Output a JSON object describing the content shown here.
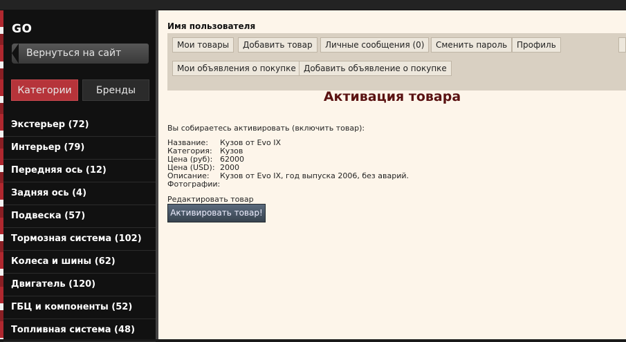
{
  "sidebar": {
    "brand": "GO",
    "back_label": "Вернуться на сайт",
    "tabs": {
      "categories": "Категории",
      "brands": "Бренды"
    },
    "categories": [
      "Экстерьер (72)",
      "Интерьер (79)",
      "Передняя ось (12)",
      "Задняя ось (4)",
      "Подвеска (57)",
      "Тормозная система (102)",
      "Колеса и шины (62)",
      "Двигатель (120)",
      "ГБЦ и компоненты (52)",
      "Топливная система (48)"
    ]
  },
  "main": {
    "user_title": "Имя пользователя",
    "menu": [
      "Мои товары",
      "Добавить товар",
      "Личные сообщения (0)",
      "Сменить пароль",
      "Профиль",
      "Мои объявления о покупке",
      "Добавить объявление о покупке"
    ],
    "heading": "Активация товара",
    "intro": "Вы собираетесь активировать (включить товар):",
    "fields": {
      "name": {
        "label": "Название:",
        "value": "Кузов от Evo IX"
      },
      "category": {
        "label": "Категория:",
        "value": "Кузов"
      },
      "price_rub": {
        "label": "Цена (руб):",
        "value": "62000"
      },
      "price_usd": {
        "label": "Цена (USD):",
        "value": "2000"
      },
      "description": {
        "label": "Описание:",
        "value": "Кузов от Evo IX, год выпуска 2006, без аварий."
      },
      "photos": {
        "label": "Фотографии:",
        "value": ""
      }
    },
    "edit_link": "Редактировать товар",
    "activate_button": "Активировать товар!"
  }
}
